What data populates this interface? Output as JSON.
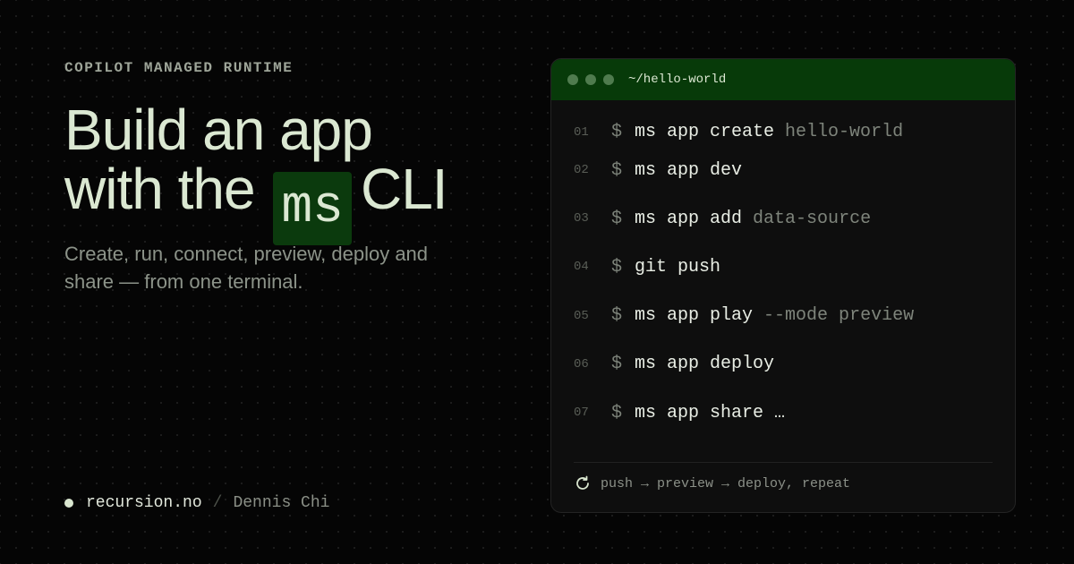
{
  "eyebrow": "COPILOT MANAGED RUNTIME",
  "headline": {
    "line1": "Build an app",
    "line2_before": "with the",
    "line2_chip": "ms",
    "line2_after": "CLI"
  },
  "subtitle": "Create, run, connect, preview, deploy and share — from one terminal.",
  "footer": {
    "site": "recursion.no",
    "separator": "/",
    "author": "Dennis Chi"
  },
  "terminal": {
    "path": "~/hello-world",
    "prompt": "$",
    "lines": [
      {
        "num": "01",
        "cmd": "ms app create",
        "arg": "hello-world"
      },
      {
        "num": "02",
        "cmd": "ms app dev",
        "arg": ""
      },
      {
        "num": "03",
        "cmd": "ms app add",
        "arg": "data-source"
      },
      {
        "num": "04",
        "cmd": "git push",
        "arg": ""
      },
      {
        "num": "05",
        "cmd": "ms app play",
        "arg": "--mode preview"
      },
      {
        "num": "06",
        "cmd": "ms app deploy",
        "arg": ""
      },
      {
        "num": "07",
        "cmd": "ms app share …",
        "arg": ""
      }
    ],
    "footer_text": "push → preview → deploy, repeat",
    "footer_icon": "refresh-icon"
  },
  "colors": {
    "background": "#050505",
    "accent_green": "#073a09",
    "headline_text": "#dbe8d2"
  }
}
